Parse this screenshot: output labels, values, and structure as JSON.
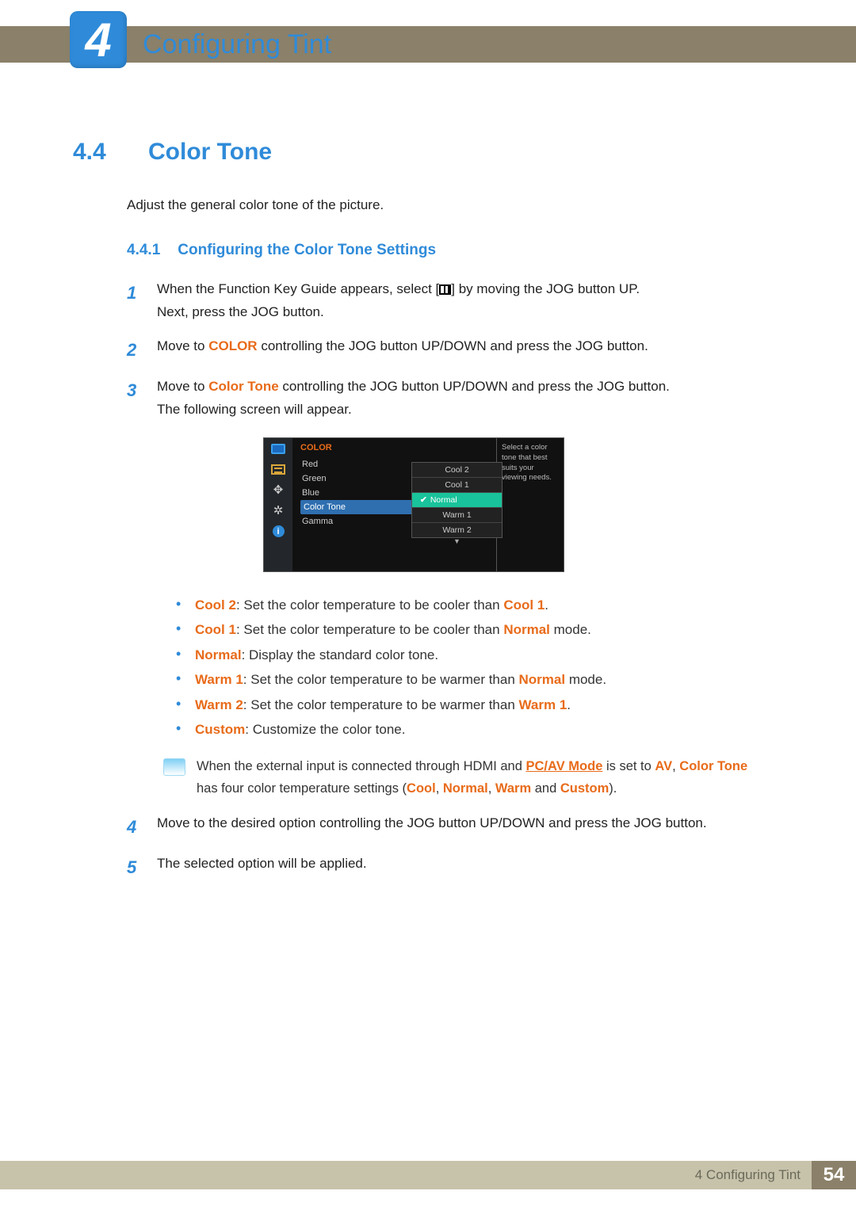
{
  "chapter": {
    "number": "4",
    "title": "Configuring Tint"
  },
  "section": {
    "number": "4.4",
    "title": "Color Tone"
  },
  "intro": "Adjust the general color tone of the picture.",
  "subsection": {
    "number": "4.4.1",
    "title": "Configuring the Color Tone Settings"
  },
  "steps": {
    "s1a": "When the Function Key Guide appears, select [",
    "s1b": "] by moving the JOG button UP.",
    "s1c": "Next, press the JOG button.",
    "s2a": "Move to ",
    "s2kw": "COLOR",
    "s2b": " controlling the JOG button UP/DOWN and press the JOG button.",
    "s3a": "Move to ",
    "s3kw": "Color Tone",
    "s3b": " controlling the JOG button UP/DOWN and press the JOG button.",
    "s3c": "The following screen will appear.",
    "s4": "Move to the desired option controlling the JOG button UP/DOWN and press the JOG button.",
    "s5": "The selected option will be applied."
  },
  "osd": {
    "title": "COLOR",
    "items": [
      "Red",
      "Green",
      "Blue",
      "Color Tone",
      "Gamma"
    ],
    "options": [
      "Cool 2",
      "Cool 1",
      "Normal",
      "Warm 1",
      "Warm 2"
    ],
    "selected_item": "Color Tone",
    "active_option": "Normal",
    "help": "Select a color tone that best suits your viewing needs."
  },
  "bullets": {
    "b1": {
      "kw": "Cool 2",
      "t1": ": Set the color temperature to be cooler than ",
      "kw2": "Cool 1",
      "t2": "."
    },
    "b2": {
      "kw": "Cool 1",
      "t1": ": Set the color temperature to be cooler than ",
      "kw2": "Normal",
      "t2": " mode."
    },
    "b3": {
      "kw": "Normal",
      "t1": ": Display the standard color tone."
    },
    "b4": {
      "kw": "Warm 1",
      "t1": ": Set the color temperature to be warmer than ",
      "kw2": "Normal",
      "t2": " mode."
    },
    "b5": {
      "kw": "Warm 2",
      "t1": ": Set the color temperature to be warmer than ",
      "kw2": "Warm 1",
      "t2": "."
    },
    "b6": {
      "kw": "Custom",
      "t1": ": Customize the color tone."
    }
  },
  "note": {
    "t1": "When the external input is connected through HDMI and ",
    "kw1": "PC/AV Mode",
    "t2": " is set to ",
    "kw2": "AV",
    "t3": ", ",
    "kw3": "Color Tone",
    "t4": " has four color temperature settings (",
    "kw4": "Cool",
    "c1": ", ",
    "kw5": "Normal",
    "c2": ", ",
    "kw6": "Warm",
    "t5": " and ",
    "kw7": "Custom",
    "t6": ")."
  },
  "footer": {
    "chapter": "4 Configuring Tint",
    "page": "54"
  },
  "num": {
    "n1": "1",
    "n2": "2",
    "n3": "3",
    "n4": "4",
    "n5": "5"
  }
}
